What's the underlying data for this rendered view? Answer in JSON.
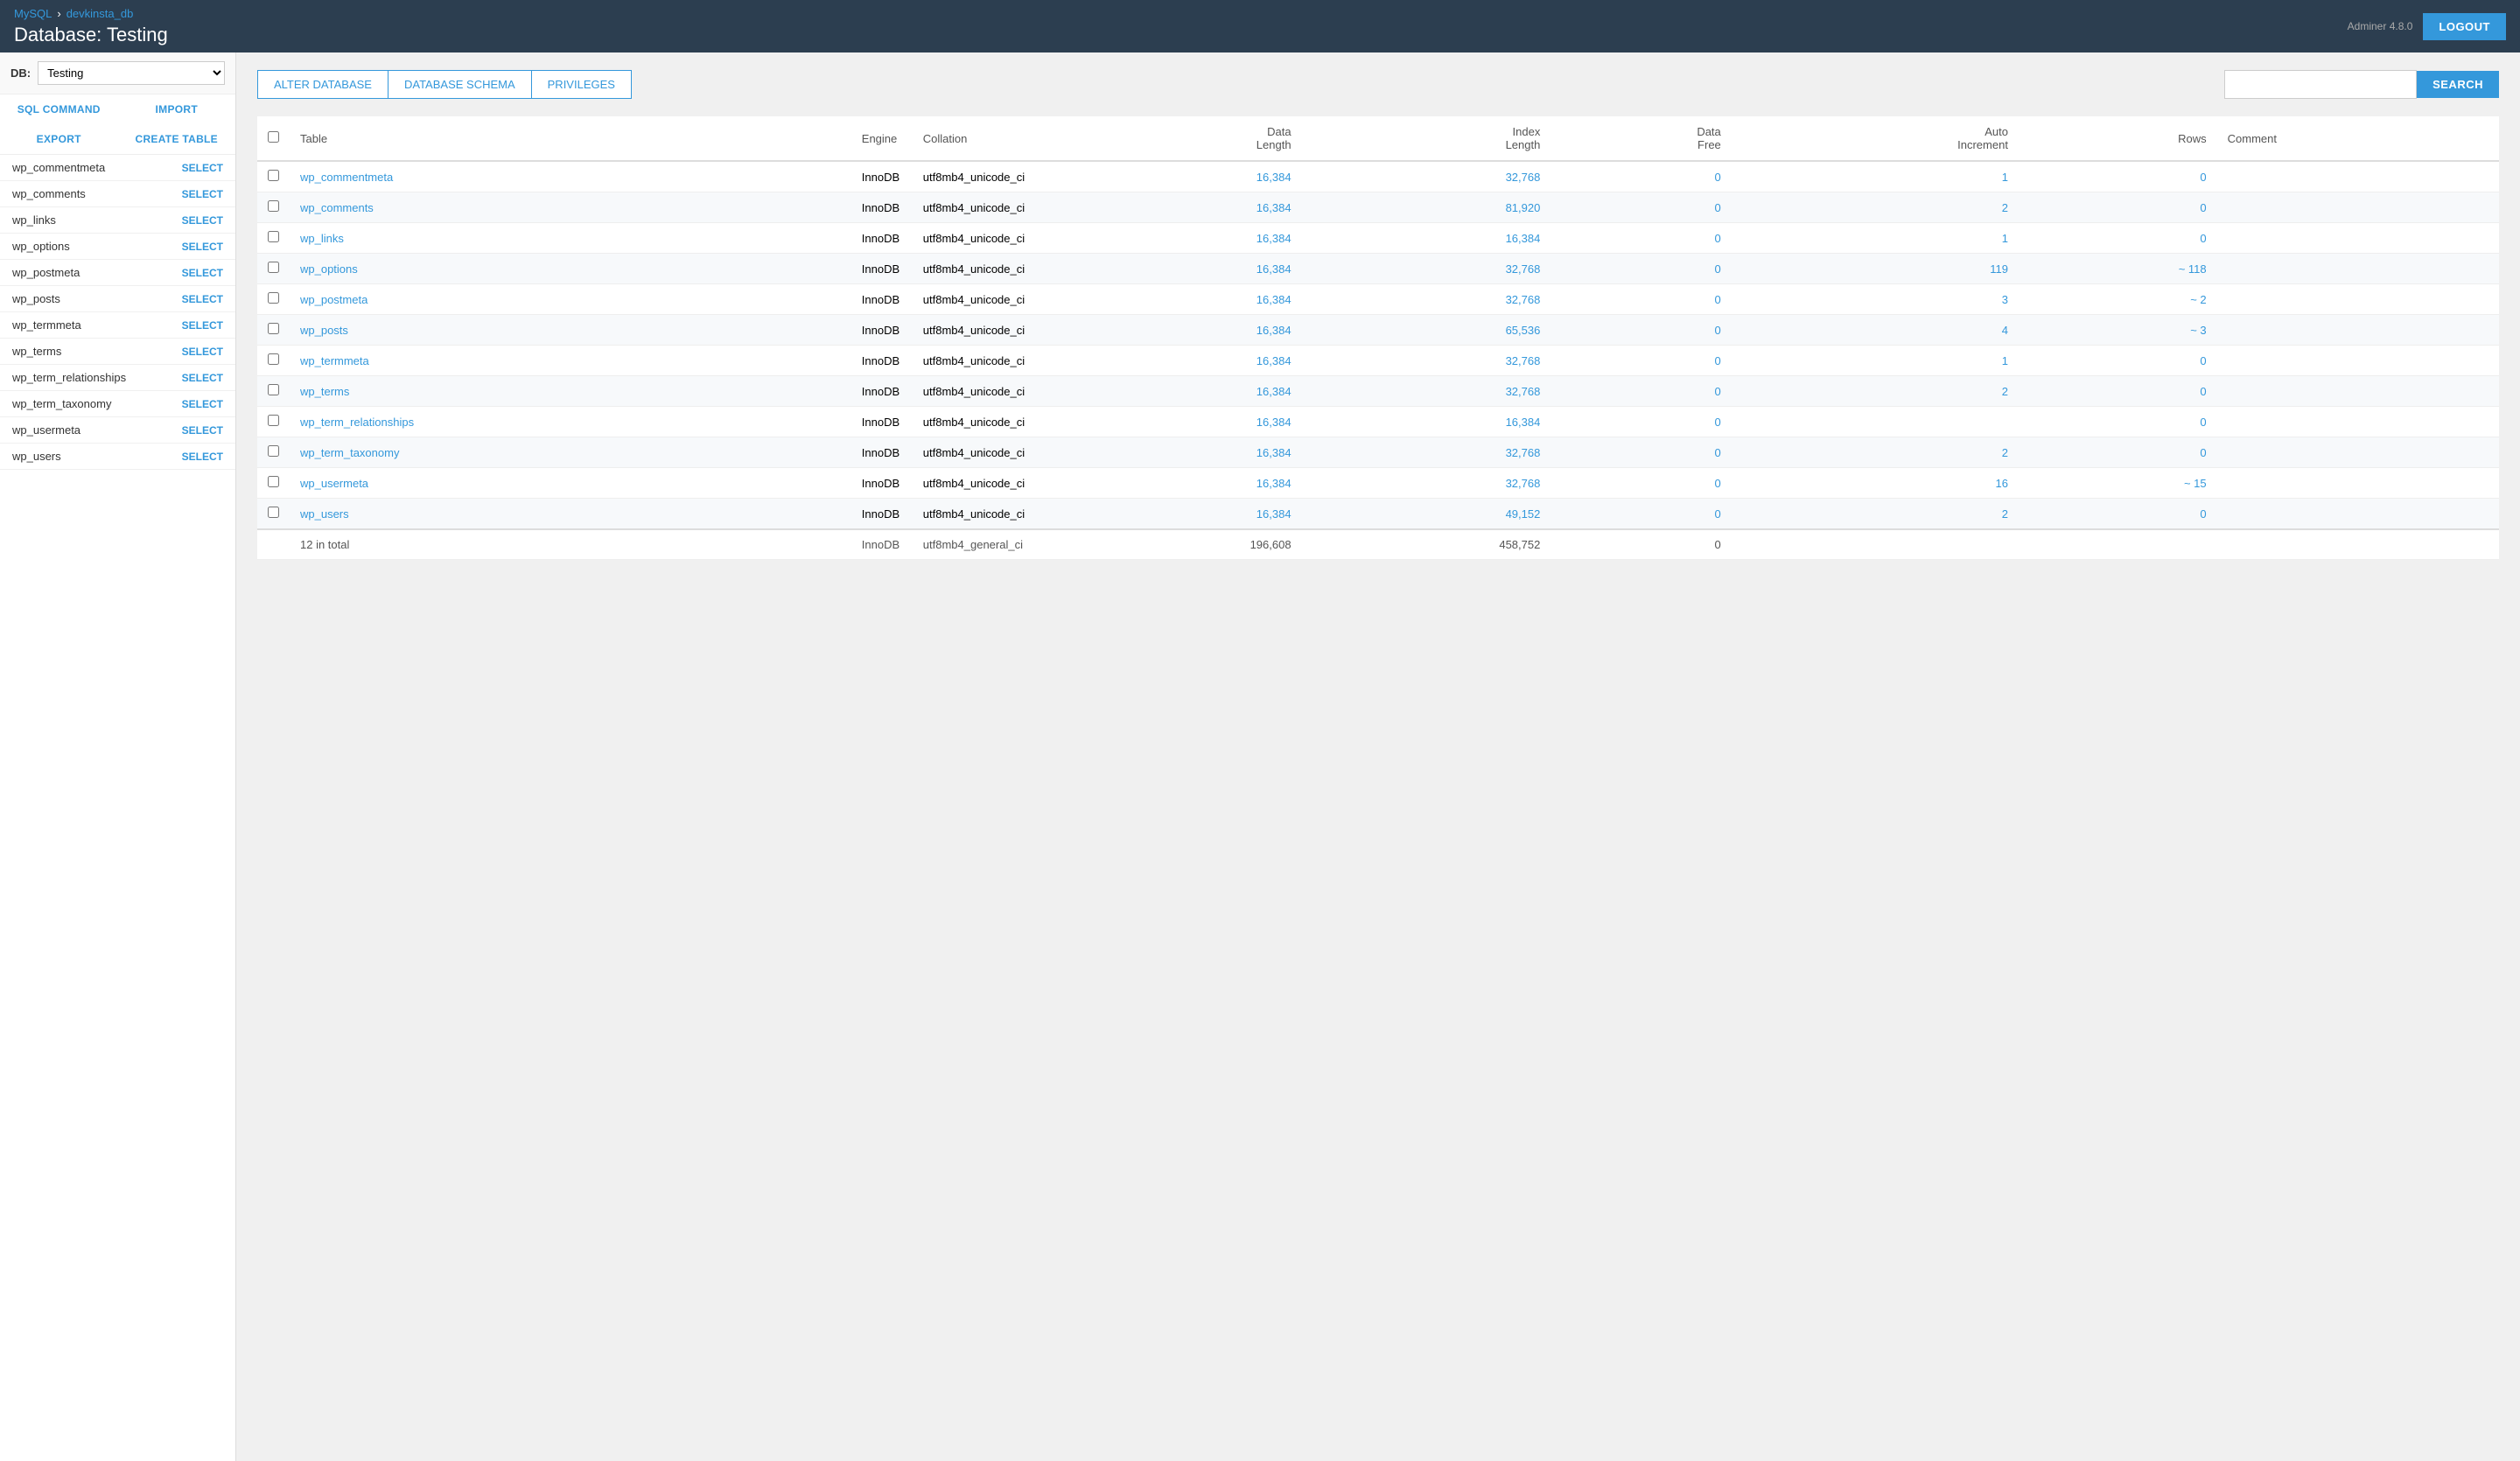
{
  "header": {
    "adminer_label": "Adminer 4.8.0",
    "logout_label": "LOGOUT",
    "breadcrumb": {
      "mysql": "MySQL",
      "db": "devkinsta_db"
    },
    "page_title": "Database: Testing"
  },
  "sidebar": {
    "db_label": "DB:",
    "db_value": "Testing",
    "nav": [
      {
        "id": "sql-command",
        "label": "SQL COMMAND"
      },
      {
        "id": "import",
        "label": "IMPORT"
      },
      {
        "id": "export",
        "label": "EXPORT"
      },
      {
        "id": "create-table",
        "label": "CREATE TABLE"
      }
    ],
    "tables": [
      {
        "name": "wp_commentmeta",
        "select": "SELECT"
      },
      {
        "name": "wp_comments",
        "select": "SELECT"
      },
      {
        "name": "wp_links",
        "select": "SELECT"
      },
      {
        "name": "wp_options",
        "select": "SELECT"
      },
      {
        "name": "wp_postmeta",
        "select": "SELECT"
      },
      {
        "name": "wp_posts",
        "select": "SELECT"
      },
      {
        "name": "wp_termmeta",
        "select": "SELECT"
      },
      {
        "name": "wp_terms",
        "select": "SELECT"
      },
      {
        "name": "wp_term_relationships",
        "select": "SELECT"
      },
      {
        "name": "wp_term_taxonomy",
        "select": "SELECT"
      },
      {
        "name": "wp_usermeta",
        "select": "SELECT"
      },
      {
        "name": "wp_users",
        "select": "SELECT"
      }
    ]
  },
  "actions": {
    "alter_db": "ALTER DATABASE",
    "db_schema": "DATABASE SCHEMA",
    "privileges": "PRIVILEGES",
    "search_placeholder": "",
    "search_btn": "SEARCH"
  },
  "table": {
    "headers": {
      "table": "Table",
      "engine": "Engine",
      "collation": "Collation",
      "data_length": "Data Length",
      "index_length": "Index Length",
      "data_free": "Data Free",
      "auto_increment": "Auto Increment",
      "rows": "Rows",
      "comment": "Comment"
    },
    "rows": [
      {
        "table": "wp_commentmeta",
        "engine": "InnoDB",
        "collation": "utf8mb4_unicode_ci",
        "data_length": "16,384",
        "index_length": "32,768",
        "data_free": "0",
        "auto_increment": "1",
        "rows": "0",
        "comment": ""
      },
      {
        "table": "wp_comments",
        "engine": "InnoDB",
        "collation": "utf8mb4_unicode_ci",
        "data_length": "16,384",
        "index_length": "81,920",
        "data_free": "0",
        "auto_increment": "2",
        "rows": "0",
        "comment": ""
      },
      {
        "table": "wp_links",
        "engine": "InnoDB",
        "collation": "utf8mb4_unicode_ci",
        "data_length": "16,384",
        "index_length": "16,384",
        "data_free": "0",
        "auto_increment": "1",
        "rows": "0",
        "comment": ""
      },
      {
        "table": "wp_options",
        "engine": "InnoDB",
        "collation": "utf8mb4_unicode_ci",
        "data_length": "16,384",
        "index_length": "32,768",
        "data_free": "0",
        "auto_increment": "119",
        "rows": "~ 118",
        "comment": ""
      },
      {
        "table": "wp_postmeta",
        "engine": "InnoDB",
        "collation": "utf8mb4_unicode_ci",
        "data_length": "16,384",
        "index_length": "32,768",
        "data_free": "0",
        "auto_increment": "3",
        "rows": "~ 2",
        "comment": ""
      },
      {
        "table": "wp_posts",
        "engine": "InnoDB",
        "collation": "utf8mb4_unicode_ci",
        "data_length": "16,384",
        "index_length": "65,536",
        "data_free": "0",
        "auto_increment": "4",
        "rows": "~ 3",
        "comment": ""
      },
      {
        "table": "wp_termmeta",
        "engine": "InnoDB",
        "collation": "utf8mb4_unicode_ci",
        "data_length": "16,384",
        "index_length": "32,768",
        "data_free": "0",
        "auto_increment": "1",
        "rows": "0",
        "comment": ""
      },
      {
        "table": "wp_terms",
        "engine": "InnoDB",
        "collation": "utf8mb4_unicode_ci",
        "data_length": "16,384",
        "index_length": "32,768",
        "data_free": "0",
        "auto_increment": "2",
        "rows": "0",
        "comment": ""
      },
      {
        "table": "wp_term_relationships",
        "engine": "InnoDB",
        "collation": "utf8mb4_unicode_ci",
        "data_length": "16,384",
        "index_length": "16,384",
        "data_free": "0",
        "auto_increment": "",
        "rows": "0",
        "comment": ""
      },
      {
        "table": "wp_term_taxonomy",
        "engine": "InnoDB",
        "collation": "utf8mb4_unicode_ci",
        "data_length": "16,384",
        "index_length": "32,768",
        "data_free": "0",
        "auto_increment": "2",
        "rows": "0",
        "comment": ""
      },
      {
        "table": "wp_usermeta",
        "engine": "InnoDB",
        "collation": "utf8mb4_unicode_ci",
        "data_length": "16,384",
        "index_length": "32,768",
        "data_free": "0",
        "auto_increment": "16",
        "rows": "~ 15",
        "comment": ""
      },
      {
        "table": "wp_users",
        "engine": "InnoDB",
        "collation": "utf8mb4_unicode_ci",
        "data_length": "16,384",
        "index_length": "49,152",
        "data_free": "0",
        "auto_increment": "2",
        "rows": "0",
        "comment": ""
      }
    ],
    "footer": {
      "summary": "12 in total",
      "engine": "InnoDB",
      "collation": "utf8mb4_general_ci",
      "data_length": "196,608",
      "index_length": "458,752",
      "data_free": "0"
    }
  }
}
